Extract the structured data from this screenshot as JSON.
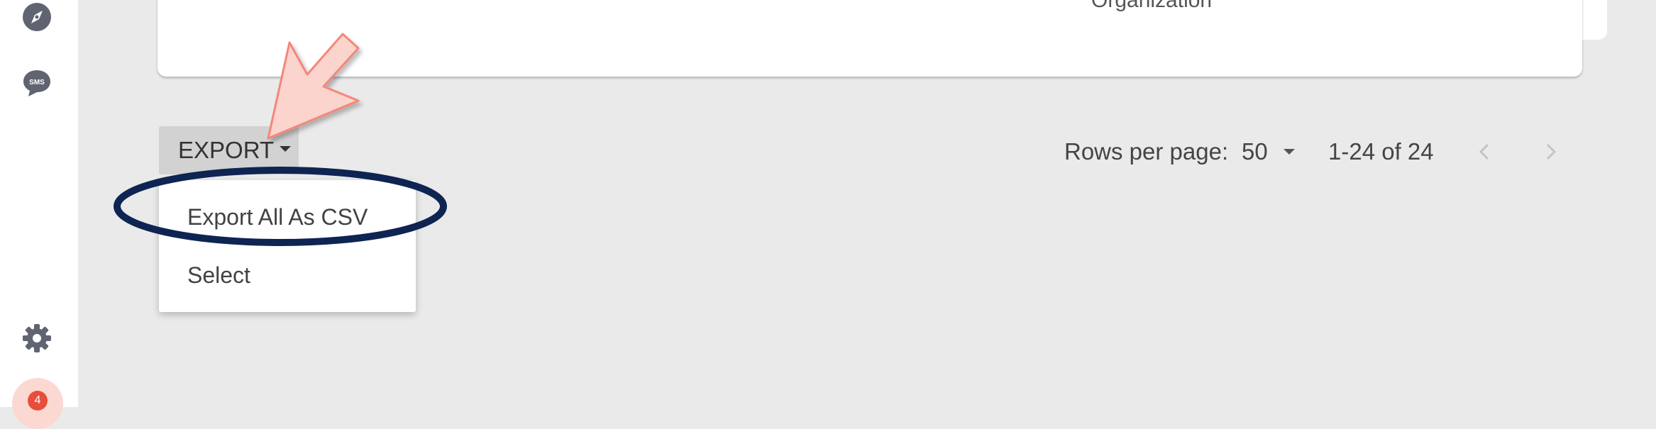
{
  "sidebar": {
    "icons": [
      "compass-icon",
      "sms-icon",
      "gear-icon"
    ],
    "sms_label": "SMS",
    "notification_count": "4"
  },
  "table": {
    "visible_header": "Organization"
  },
  "export": {
    "label": "EXPORT",
    "menu_items": [
      "Export All As CSV",
      "Select"
    ]
  },
  "pagination": {
    "rows_per_page_label": "Rows per page:",
    "rows_per_page_value": "50",
    "range_text": "1-24 of 24"
  },
  "annotations": {
    "arrow_color": "#f4877a",
    "highlight_color": "#0e2452"
  }
}
